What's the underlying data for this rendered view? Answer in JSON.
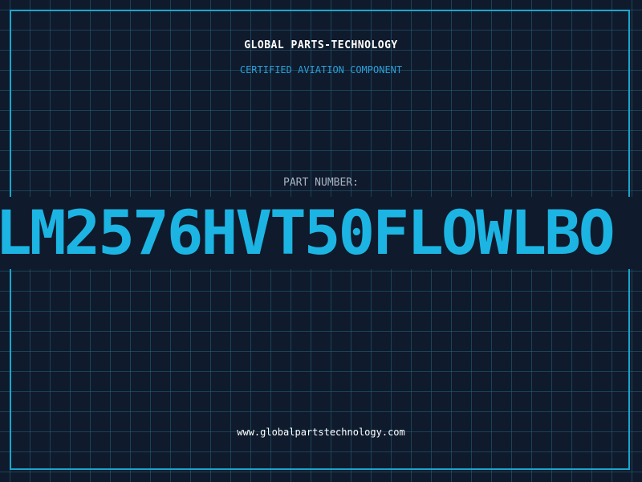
{
  "header": {
    "company": "GLOBAL PARTS-TECHNOLOGY",
    "subtitle": "CERTIFIED AVIATION COMPONENT"
  },
  "part": {
    "label": "PART NUMBER:",
    "number": "LM2576HVT50FLOWLBO"
  },
  "footer": {
    "website": "www.globalpartstechnology.com"
  },
  "colors": {
    "background": "#0f1a2c",
    "grid": "#22627a",
    "frame": "#1aa6cc",
    "accent": "#1cb4e3",
    "subtitle": "#2a9fd6"
  }
}
